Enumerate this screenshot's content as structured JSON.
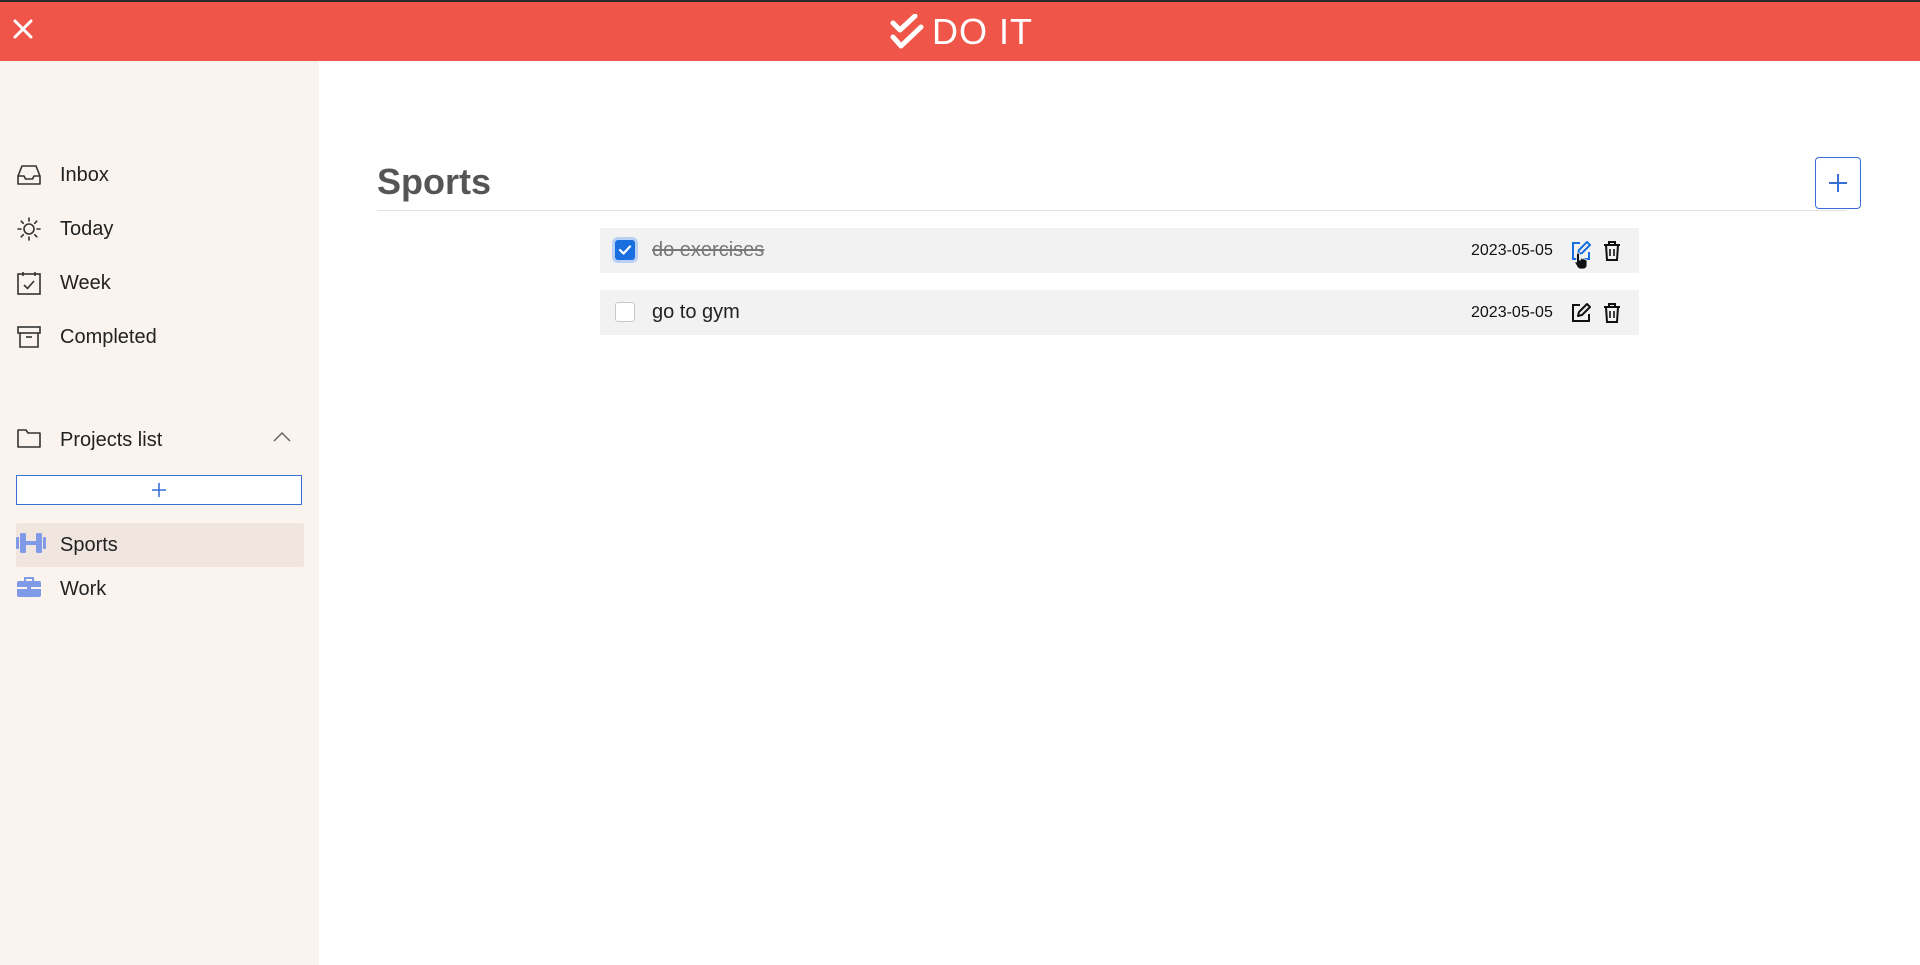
{
  "app": {
    "brand": "DO IT"
  },
  "colors": {
    "header": "#ef5548",
    "sidebar": "#fbf4ee",
    "accent": "#1a6fe0",
    "project_icon": "#7f9be8"
  },
  "sidebar": {
    "nav": [
      {
        "label": "Inbox",
        "icon": "inbox-icon"
      },
      {
        "label": "Today",
        "icon": "sun-icon"
      },
      {
        "label": "Week",
        "icon": "calendar-check-icon"
      },
      {
        "label": "Completed",
        "icon": "archive-icon"
      }
    ],
    "projects_header": "Projects list",
    "projects": [
      {
        "label": "Sports",
        "icon": "dumbbell-icon",
        "active": true
      },
      {
        "label": "Work",
        "icon": "briefcase-icon",
        "active": false
      }
    ]
  },
  "main": {
    "title": "Sports",
    "tasks": [
      {
        "name": "do exercises",
        "date": "2023-05-05",
        "completed": true
      },
      {
        "name": "go to gym",
        "date": "2023-05-05",
        "completed": false
      }
    ]
  }
}
